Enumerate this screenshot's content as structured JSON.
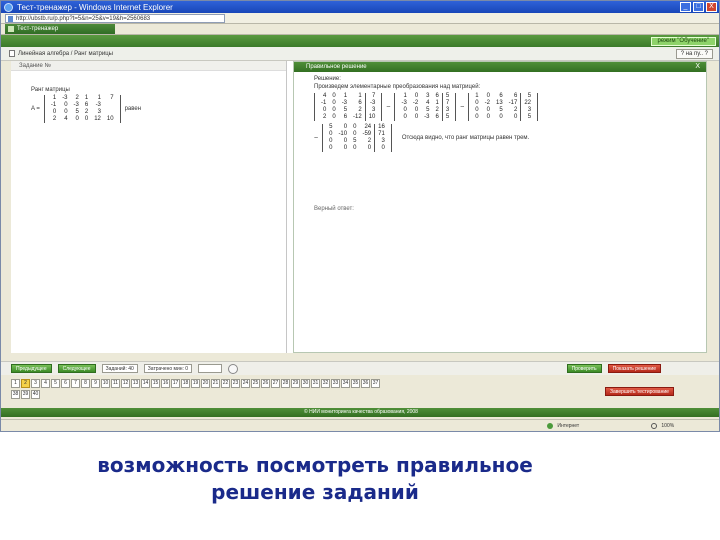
{
  "window": {
    "title": "Тест-тренажер - Windows Internet Explorer",
    "controls": [
      "_",
      "□",
      "X"
    ]
  },
  "address": {
    "url": "http://ubstb.ru/p.php?t=5&n=25&v=19&h=2560683"
  },
  "favorites": {
    "tab_label": "Тест-тренажер"
  },
  "app": {
    "title": "",
    "mode_button": "режим \"Обучение\""
  },
  "nav": {
    "breadcrumb": "Линейная алгебра / Ранг матрицы",
    "help_label": "? на пу..  ?"
  },
  "left_pane": {
    "header": "Задание №",
    "task_label": "Ранг матрицы",
    "matrix_name": "A =",
    "matrix": [
      [
        "1",
        "-3",
        "2",
        "1",
        "1",
        "7"
      ],
      [
        "-1",
        "0",
        "-3",
        "6",
        "-3",
        ""
      ],
      [
        "0",
        "0",
        "5",
        "2",
        "3",
        ""
      ],
      [
        "2",
        "4",
        "0",
        "0",
        "12",
        "10"
      ]
    ],
    "matrix_suffix": "равен"
  },
  "right_pane": {
    "header": "Правильное решение",
    "close": "X",
    "title": "Решение:",
    "subtitle": "Произведем элементарные преобразования над матрицей:",
    "step1_left": [
      [
        "4",
        "0",
        "1",
        "1",
        "7"
      ],
      [
        "-1",
        "0",
        "-3",
        "6",
        "-3"
      ],
      [
        "0",
        "0",
        "5",
        "2",
        "3"
      ],
      [
        "2",
        "0",
        "6",
        "-12",
        "10"
      ]
    ],
    "step1_mid": [
      [
        "1",
        "0",
        "3",
        "6",
        "5"
      ],
      [
        "-3",
        "-2",
        "4",
        "1",
        "7"
      ],
      [
        "0",
        "0",
        "5",
        "2",
        "3"
      ],
      [
        "0",
        "0",
        "-3",
        "6",
        "5"
      ]
    ],
    "step1_right": [
      [
        "1",
        "0",
        "6",
        "6",
        "5"
      ],
      [
        "0",
        "-2",
        "13",
        "-17",
        "22"
      ],
      [
        "0",
        "0",
        "5",
        "2",
        "3"
      ],
      [
        "0",
        "0",
        "0",
        "0",
        "5"
      ]
    ],
    "step2": [
      [
        "5",
        "0",
        "0",
        "24",
        "16"
      ],
      [
        "0",
        "-10",
        "0",
        "-59",
        "71"
      ],
      [
        "0",
        "0",
        "5",
        "2",
        "3"
      ],
      [
        "0",
        "0",
        "0",
        "0",
        "0"
      ]
    ],
    "op_arrow": "~",
    "conclusion": "Отсюда видно, что ранг матрицы равен трем.",
    "answer_label": "Верный ответ:"
  },
  "controls": {
    "prev": "Предыдущее",
    "next": "Следующее",
    "tasks_total": "Заданий: 40",
    "time": "Затрачено мин: 0",
    "small_field": "",
    "check": "Проверить",
    "show_solution": "Показать решение"
  },
  "task_numbers_row1": [
    "1",
    "2",
    "3",
    "4",
    "5",
    "6",
    "7",
    "8",
    "9",
    "10",
    "11",
    "12",
    "13",
    "14",
    "15",
    "16",
    "17",
    "18",
    "19",
    "20",
    "21",
    "22",
    "23",
    "24",
    "25",
    "26",
    "27",
    "28",
    "29",
    "30",
    "31",
    "32",
    "33",
    "34",
    "35",
    "36",
    "37"
  ],
  "task_numbers_row2": [
    "38",
    "39",
    "40"
  ],
  "current_task": "2",
  "finish": "Завершить тестирование",
  "footer": "© НИИ мониторинга качества образования, 2008",
  "status": {
    "zone": "Интернет",
    "zoom": "100%"
  },
  "caption": {
    "line1": "возможность посмотреть правильное",
    "line2": "решение заданий"
  },
  "colors": {
    "accent_green": "#3b7a2a",
    "button_red": "#b5281a",
    "caption_blue": "#1a2a8a"
  }
}
